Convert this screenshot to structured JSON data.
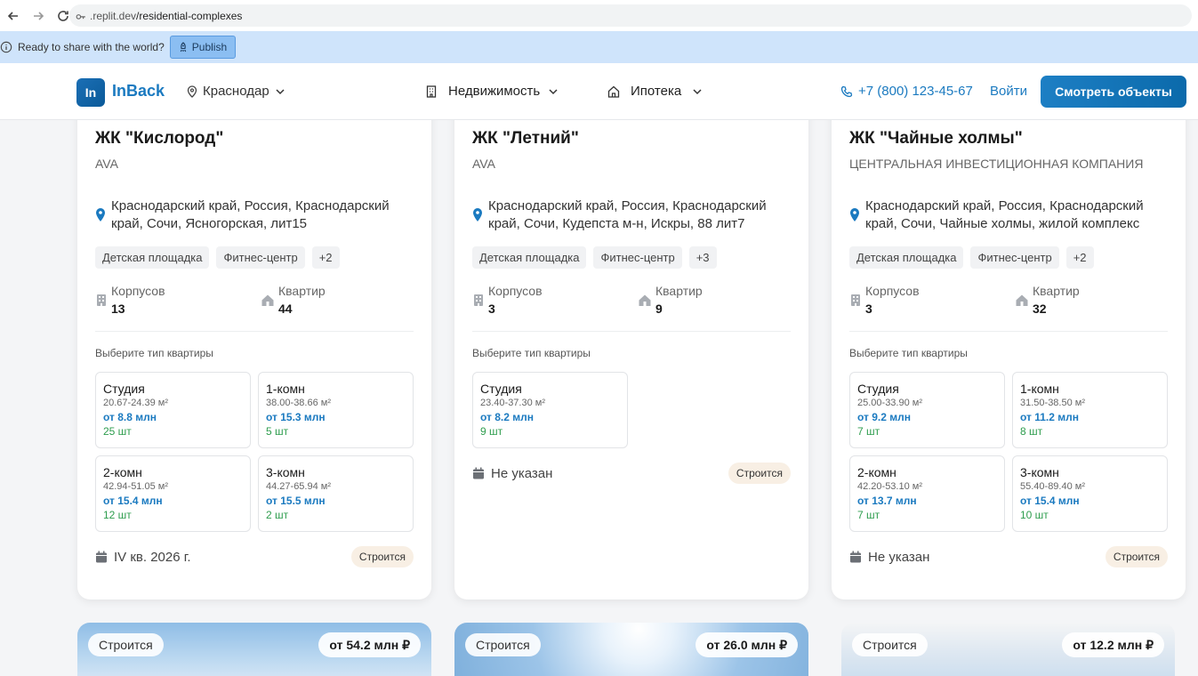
{
  "browser": {
    "url_host": ".replit.dev",
    "url_path": "/residential-complexes"
  },
  "publish_bar": {
    "message": "Ready to share with the world?",
    "button": "Publish"
  },
  "header": {
    "logo_mark": "In",
    "logo_text": "InBack",
    "city": "Краснодар",
    "nav": [
      "Недвижимость",
      "Ипотека"
    ],
    "phone": "+7 (800) 123-45-67",
    "login": "Войти",
    "cta": "Смотреть объекты"
  },
  "labels": {
    "buildings": "Корпусов",
    "apartments": "Квартир",
    "choose_type": "Выберите тип квартиры"
  },
  "cards": [
    {
      "title": "ЖК \"Кислород\"",
      "developer": "AVA",
      "address": "Краснодарский край, Россия, Краснодарский край, Сочи, Ясногорская, лит15",
      "tags": [
        "Детская площадка",
        "Фитнес-центр",
        "+2"
      ],
      "buildings": "13",
      "apartments": "44",
      "types": [
        {
          "name": "Студия",
          "area": "20.67-24.39 м²",
          "price": "от 8.8 млн",
          "count": "25 шт"
        },
        {
          "name": "1-комн",
          "area": "38.00-38.66 м²",
          "price": "от 15.3 млн",
          "count": "5 шт"
        },
        {
          "name": "2-комн",
          "area": "42.94-51.05 м²",
          "price": "от 15.4 млн",
          "count": "12 шт"
        },
        {
          "name": "3-комн",
          "area": "44.27-65.94 м²",
          "price": "от 15.5 млн",
          "count": "2 шт"
        }
      ],
      "deadline": "IV кв. 2026 г.",
      "status": "Строится"
    },
    {
      "title": "ЖК \"Летний\"",
      "developer": "AVA",
      "address": "Краснодарский край, Россия, Краснодарский край, Сочи, Кудепста м-н, Искры, 88 лит7",
      "tags": [
        "Детская площадка",
        "Фитнес-центр",
        "+3"
      ],
      "buildings": "3",
      "apartments": "9",
      "types": [
        {
          "name": "Студия",
          "area": "23.40-37.30 м²",
          "price": "от 8.2 млн",
          "count": "9 шт"
        }
      ],
      "deadline": "Не указан",
      "status": "Строится"
    },
    {
      "title": "ЖК \"Чайные холмы\"",
      "developer": "ЦЕНТРАЛЬНАЯ ИНВЕСТИЦИОННАЯ КОМПАНИЯ",
      "address": "Краснодарский край, Россия, Краснодарский край, Сочи, Чайные холмы, жилой комплекс",
      "tags": [
        "Детская площадка",
        "Фитнес-центр",
        "+2"
      ],
      "buildings": "3",
      "apartments": "32",
      "types": [
        {
          "name": "Студия",
          "area": "25.00-33.90 м²",
          "price": "от 9.2 млн",
          "count": "7 шт"
        },
        {
          "name": "1-комн",
          "area": "31.50-38.50 м²",
          "price": "от 11.2 млн",
          "count": "8 шт"
        },
        {
          "name": "2-комн",
          "area": "42.20-53.10 м²",
          "price": "от 13.7 млн",
          "count": "7 шт"
        },
        {
          "name": "3-комн",
          "area": "55.40-89.40 м²",
          "price": "от 15.4 млн",
          "count": "10 шт"
        }
      ],
      "deadline": "Не указан",
      "status": "Строится"
    }
  ],
  "image_cards": [
    {
      "status": "Строится",
      "price": "от 54.2 млн ₽"
    },
    {
      "status": "Строится",
      "price": "от 26.0 млн ₽"
    },
    {
      "status": "Строится",
      "price": "от 12.2 млн ₽"
    }
  ],
  "colors": {
    "accent": "#1b7ac0",
    "count_green": "#2e9d4e",
    "publish_bar": "#cfe4fb"
  }
}
